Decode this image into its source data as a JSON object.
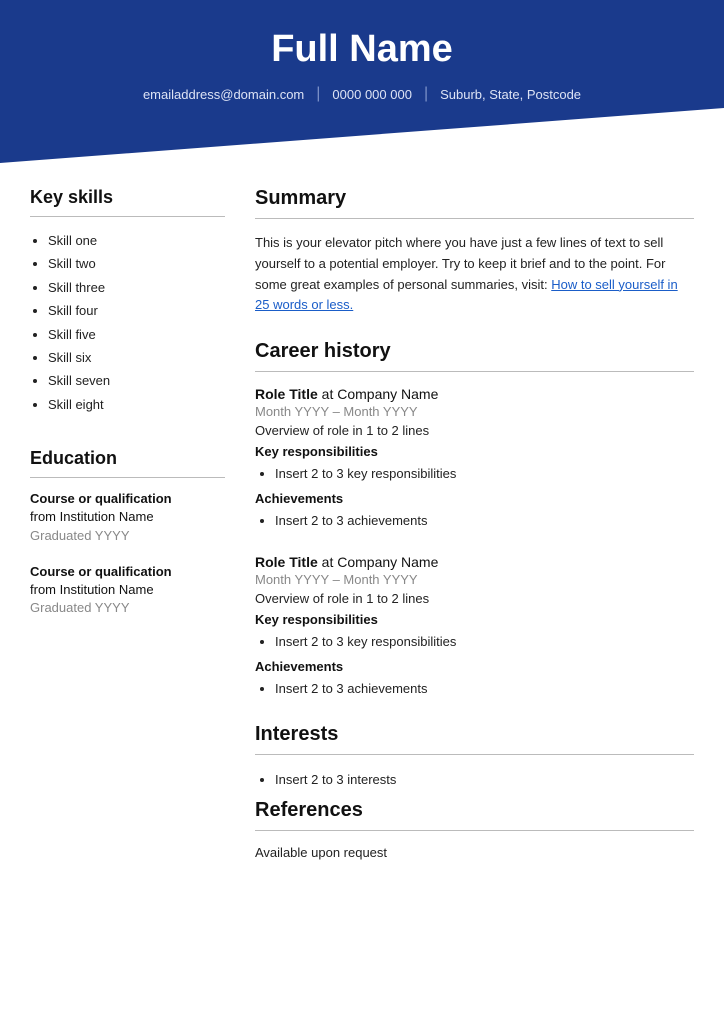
{
  "header": {
    "name": "Full Name",
    "email": "emailaddress@domain.com",
    "phone": "0000 000 000",
    "location": "Suburb, State, Postcode"
  },
  "left": {
    "skills_heading": "Key skills",
    "skills": [
      "Skill one",
      "Skill two",
      "Skill three",
      "Skill four",
      "Skill five",
      "Skill six",
      "Skill seven",
      "Skill eight"
    ],
    "education_heading": "Education",
    "education": [
      {
        "course": "Course or qualification",
        "institution": "from Institution Name",
        "grad": "Graduated YYYY"
      },
      {
        "course": "Course or qualification",
        "institution": "from Institution Name",
        "grad": "Graduated YYYY"
      }
    ]
  },
  "right": {
    "summary_heading": "Summary",
    "summary_text": "This is your elevator pitch where you have just a few lines of text to sell yourself to a potential employer. Try to keep it brief and to the point. For some great examples of personal summaries, visit: ",
    "summary_link_text": "How to sell yourself in 25 words or less.",
    "career_heading": "Career history",
    "jobs": [
      {
        "role_bold": "Role Title",
        "role_rest": " at Company Name",
        "dates": "Month YYYY – Month YYYY",
        "overview": "Overview of role in 1 to 2 lines",
        "responsibilities_heading": "Key responsibilities",
        "responsibilities": [
          "Insert 2 to 3 key responsibilities"
        ],
        "achievements_heading": "Achievements",
        "achievements": [
          "Insert 2 to 3 achievements"
        ]
      },
      {
        "role_bold": "Role Title",
        "role_rest": " at Company Name",
        "dates": "Month YYYY – Month YYYY",
        "overview": "Overview of role in 1 to 2 lines",
        "responsibilities_heading": "Key responsibilities",
        "responsibilities": [
          "Insert 2 to 3 key responsibilities"
        ],
        "achievements_heading": "Achievements",
        "achievements": [
          "Insert 2 to 3 achievements"
        ]
      }
    ],
    "interests_heading": "Interests",
    "interests": [
      "Insert 2 to 3 interests"
    ],
    "references_heading": "References",
    "references_text": "Available upon request"
  }
}
